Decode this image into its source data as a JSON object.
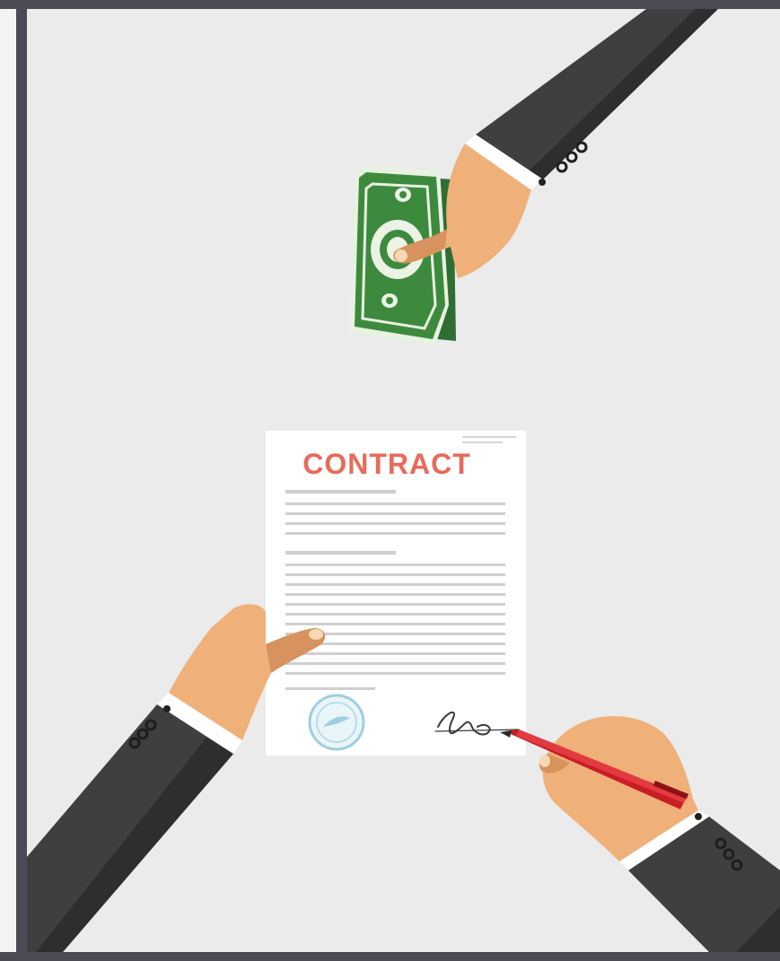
{
  "document": {
    "title": "CONTRACT"
  },
  "colors": {
    "background": "#eaebea",
    "frame": "#4d4a56",
    "suit": "#3f3f41",
    "suit_shade": "#2e2e30",
    "skin": "#f0b07a",
    "skin_shade": "#d7925d",
    "cuff": "#ffffff",
    "money_green": "#3d8a3f",
    "money_light": "#7cc47a",
    "paper": "#ffffff",
    "text_lines": "#c9c9c9",
    "title_red": "#e86a5a",
    "pen_red": "#c81d25",
    "stamp_blue": "#9ecfe0"
  },
  "icons": {
    "money": "banknote-icon",
    "stamp": "seal-stamp-icon",
    "pen": "pen-icon",
    "signature": "signature-mark"
  }
}
